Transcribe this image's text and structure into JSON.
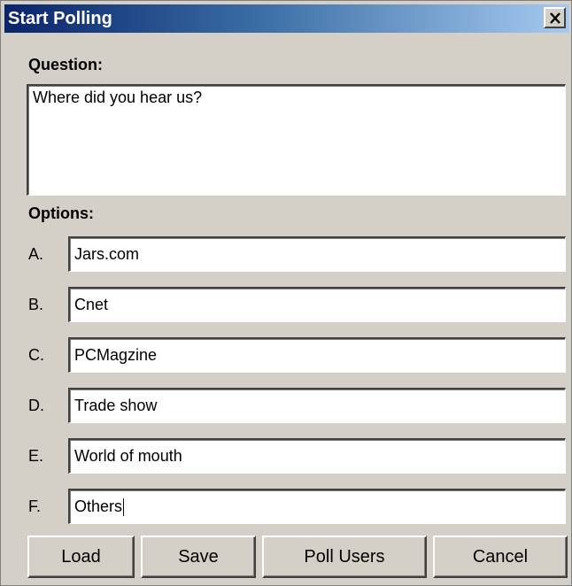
{
  "window": {
    "title": "Start Polling",
    "close_icon": "close-icon"
  },
  "question": {
    "label": "Question:",
    "value": "Where did you hear us?"
  },
  "options": {
    "label": "Options:",
    "items": [
      {
        "letter": "A.",
        "value": "Jars.com"
      },
      {
        "letter": "B.",
        "value": "Cnet"
      },
      {
        "letter": "C.",
        "value": "PCMagzine"
      },
      {
        "letter": "D.",
        "value": "Trade show"
      },
      {
        "letter": "E.",
        "value": "World of mouth"
      },
      {
        "letter": "F.",
        "value": "Others"
      }
    ]
  },
  "buttons": {
    "load": "Load",
    "save": "Save",
    "poll_users": "Poll Users",
    "cancel": "Cancel"
  }
}
